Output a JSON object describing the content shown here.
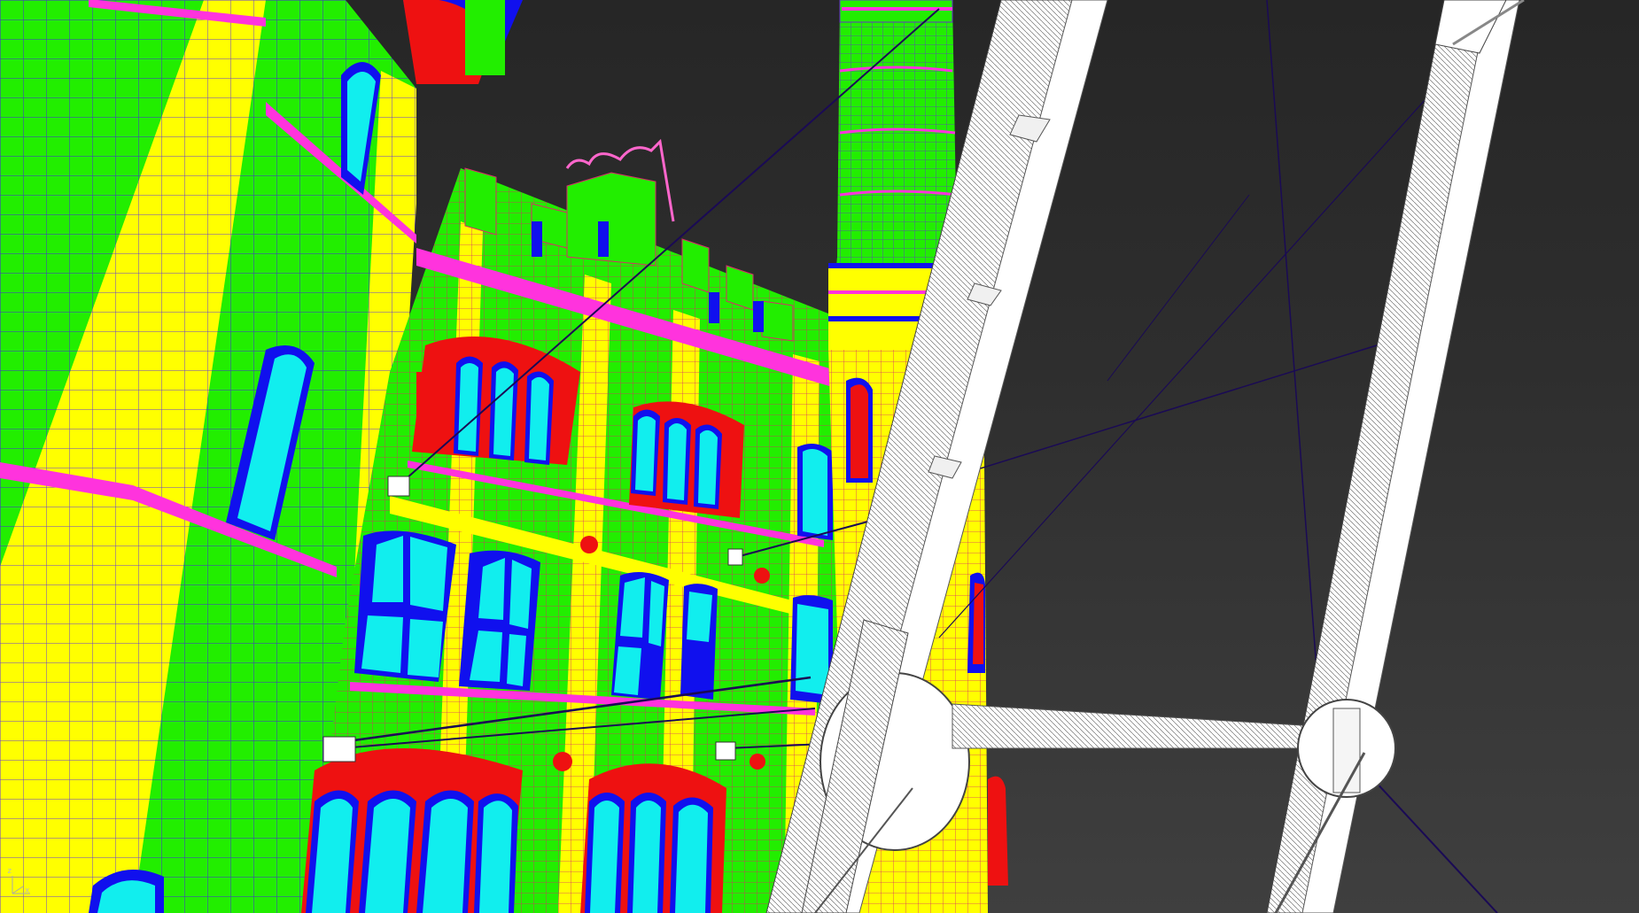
{
  "viewport": {
    "background_top": "#262626",
    "background_bottom": "#3f3f3f"
  },
  "colors": {
    "green": "#22ee00",
    "yellow": "#ffff00",
    "magenta": "#ff33dd",
    "blue": "#1010ee",
    "cyan": "#11eeee",
    "red": "#ee1111",
    "white": "#ffffff",
    "wire": "#5500aa"
  },
  "gizmo": {
    "z": "z",
    "x": "x",
    "y": "y"
  }
}
